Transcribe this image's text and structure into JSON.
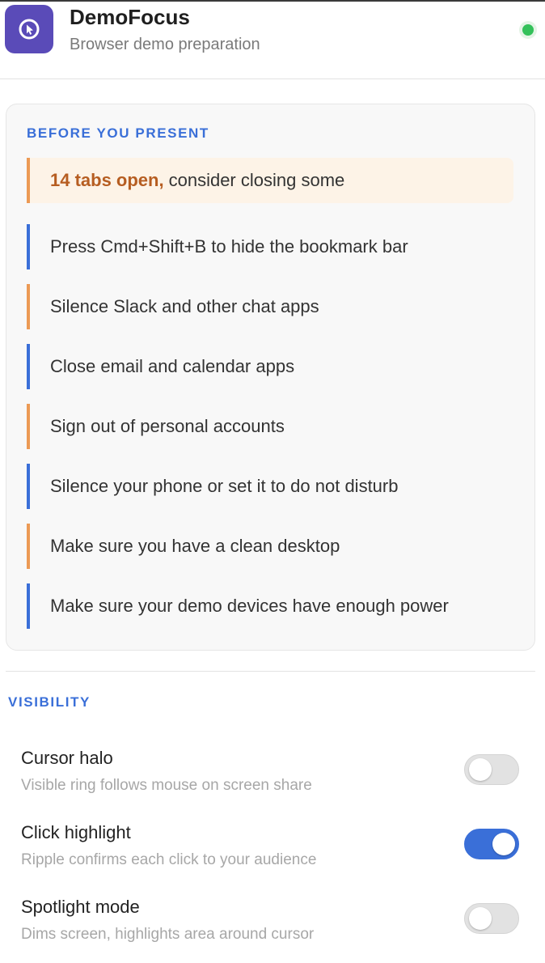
{
  "app": {
    "title": "DemoFocus",
    "subtitle": "Browser demo preparation",
    "icon": "cursor-click-icon",
    "status": "active"
  },
  "checklist": {
    "heading": "BEFORE YOU PRESENT",
    "warning": {
      "strong": "14 tabs open,",
      "text": "consider closing some"
    },
    "items": [
      {
        "label": "Press Cmd+Shift+B to hide the bookmark bar",
        "accent": "blue"
      },
      {
        "label": "Silence Slack and other chat apps",
        "accent": "orange"
      },
      {
        "label": "Close email and calendar apps",
        "accent": "blue"
      },
      {
        "label": "Sign out of personal accounts",
        "accent": "orange"
      },
      {
        "label": "Silence your phone or set it to do not disturb",
        "accent": "blue"
      },
      {
        "label": "Make sure you have a clean desktop",
        "accent": "orange"
      },
      {
        "label": "Make sure your demo devices have enough power",
        "accent": "blue"
      }
    ]
  },
  "visibility": {
    "heading": "VISIBILITY",
    "toggles": [
      {
        "title": "Cursor halo",
        "description": "Visible ring follows mouse on screen share",
        "on": false
      },
      {
        "title": "Click highlight",
        "description": "Ripple confirms each click to your audience",
        "on": true
      },
      {
        "title": "Spotlight mode",
        "description": "Dims screen, highlights area around cursor",
        "on": false
      }
    ]
  },
  "colors": {
    "accent_blue": "#3a6fd8",
    "accent_orange": "#ec9a55",
    "warning_text": "#b65d21",
    "app_icon_bg": "#5a4bb8",
    "status_green": "#34c15a"
  }
}
